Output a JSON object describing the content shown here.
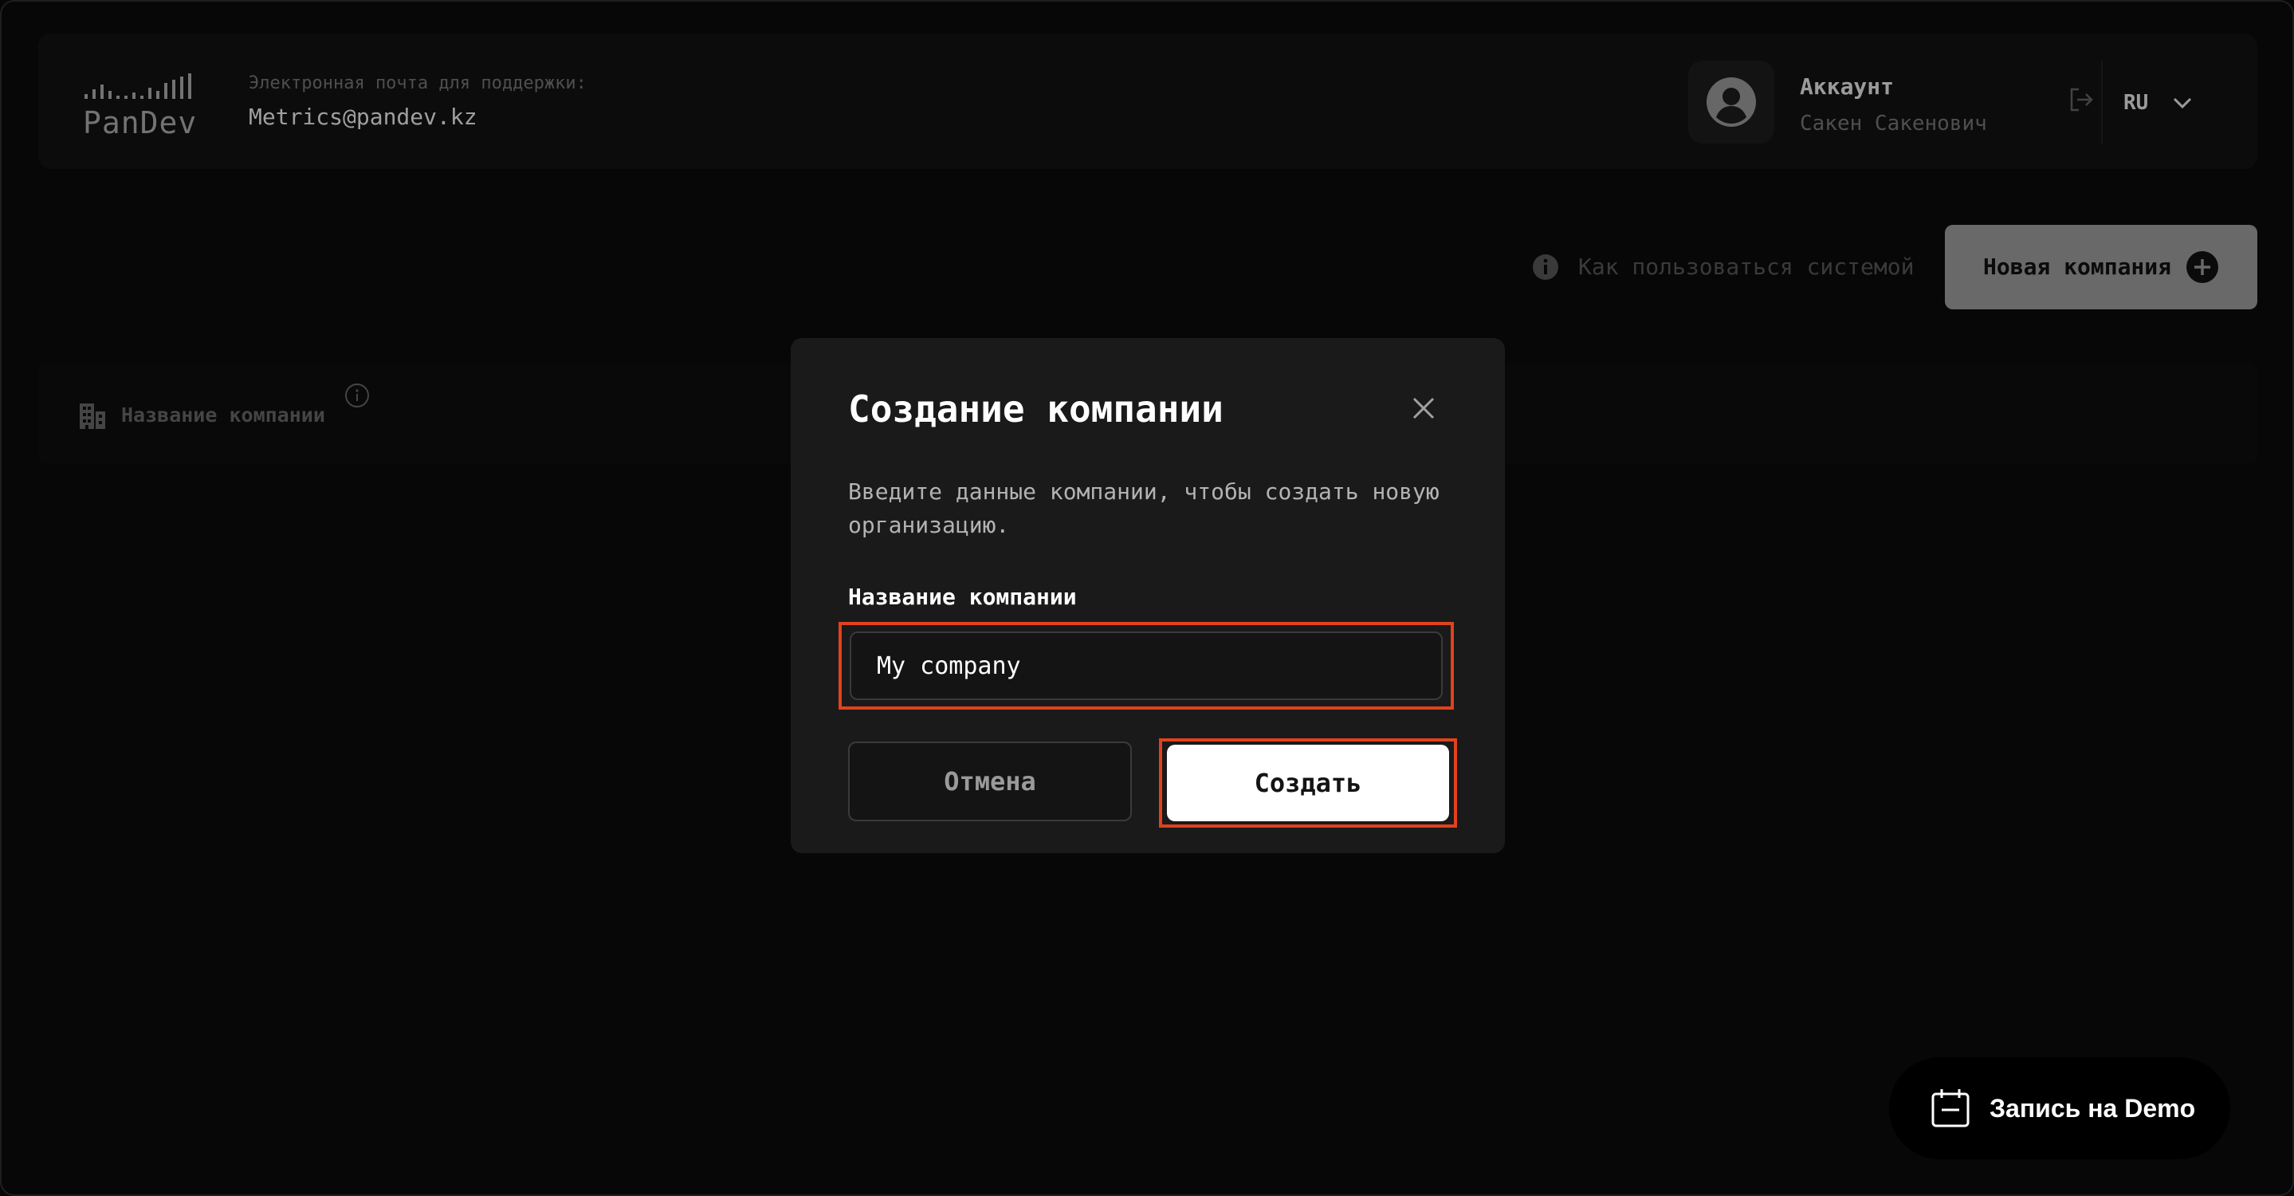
{
  "header": {
    "logo_text": "PanDev",
    "support_label": "Электронная почта для поддержки:",
    "support_email": "Metrics@pandev.kz",
    "account_label": "Аккаунт",
    "account_name": "Сакен Сакенович",
    "language": "RU"
  },
  "toolbar": {
    "help_text": "Как пользоваться системой",
    "new_company_label": "Новая компания"
  },
  "table": {
    "column_title": "Название компании"
  },
  "modal": {
    "title": "Создание компании",
    "description": "Введите данные компании, чтобы создать новую организацию.",
    "field_label": "Название компании",
    "field_value": "My company",
    "cancel_label": "Отмена",
    "create_label": "Создать"
  },
  "demo": {
    "label": "Запись на Demo"
  },
  "colors": {
    "background": "#0a0a0a",
    "panel": "#111111",
    "modal": "#1a1a1a",
    "highlight": "#e0421d",
    "primary_button": "#ffffff",
    "new_company_button": "#8c8c8c"
  },
  "icons": [
    "logo-bars-icon",
    "avatar-icon",
    "logout-icon",
    "chevron-down-icon",
    "info-icon",
    "plus-circle-icon",
    "building-icon",
    "close-icon",
    "calendar-icon"
  ]
}
